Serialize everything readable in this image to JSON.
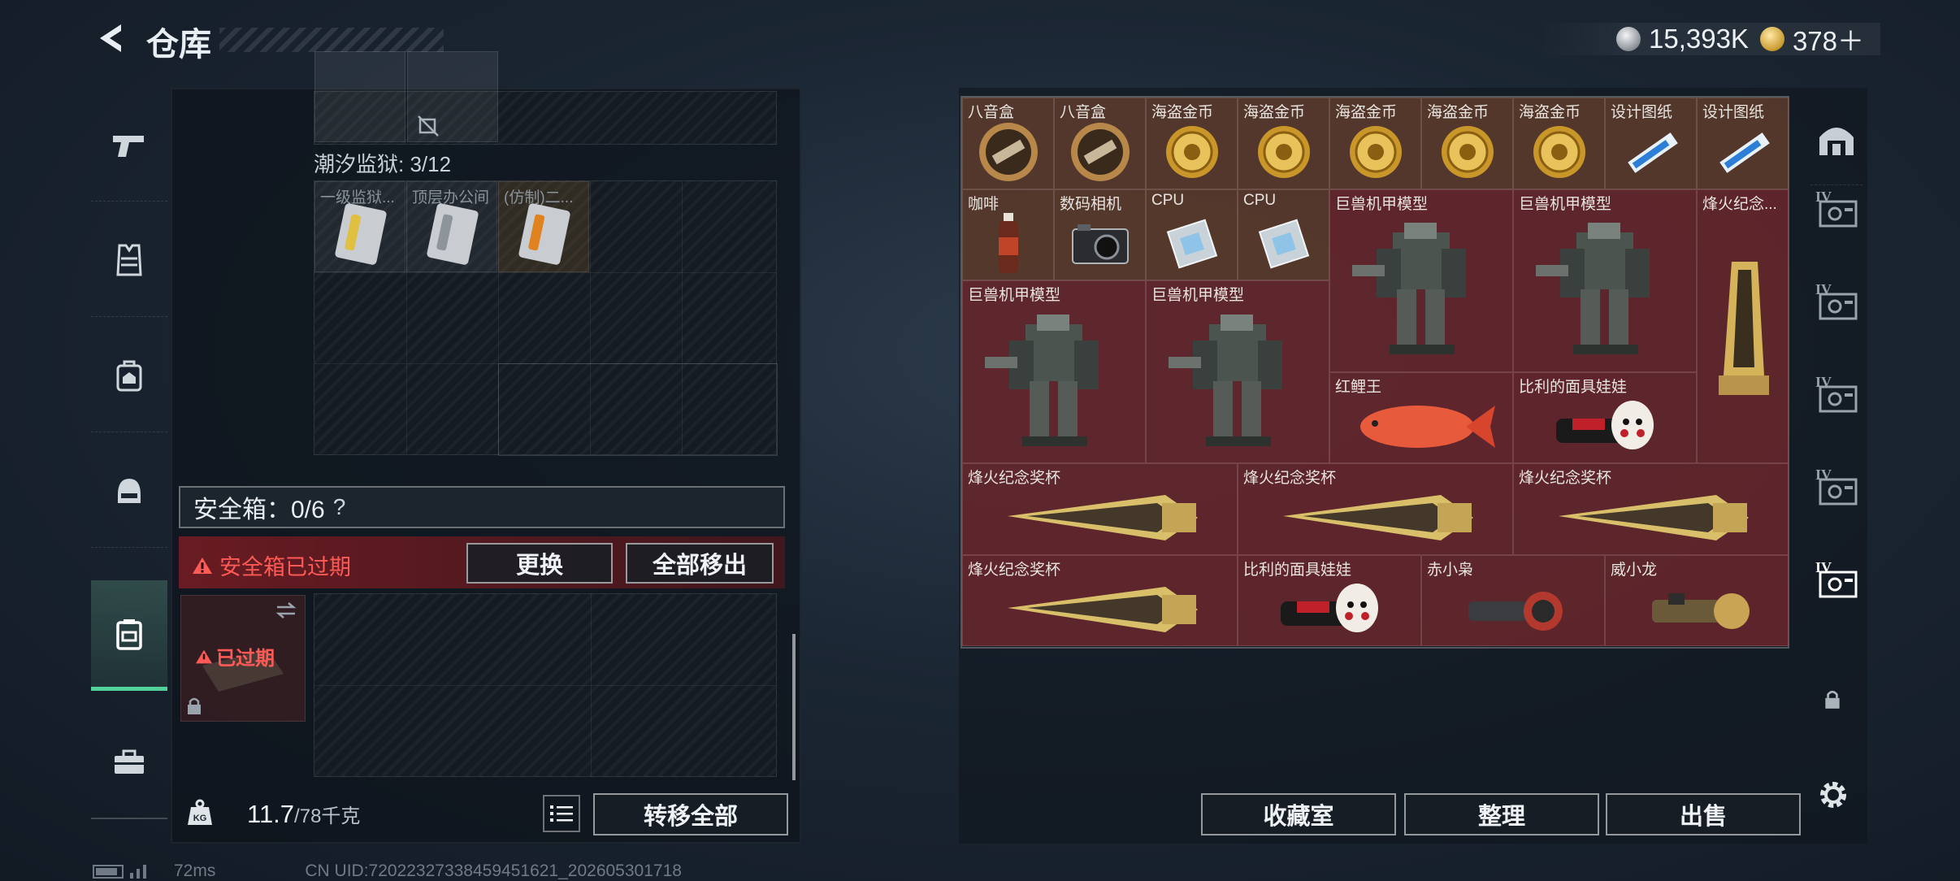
{
  "header": {
    "title": "仓库",
    "currency": [
      {
        "icon": "silver-coin-icon",
        "value": "15,393K"
      },
      {
        "icon": "gold-coin-icon",
        "value": "378＋"
      }
    ]
  },
  "left_nav": [
    "pistol-icon",
    "vest-icon",
    "backpack-icon",
    "helmet-icon",
    "safebox-icon",
    "toolbox-icon"
  ],
  "left_panel": {
    "container_label": "潮汐监狱: 3/12",
    "container_items": [
      {
        "label": "一级监狱...",
        "color": "#e0c040"
      },
      {
        "label": "顶层办公间",
        "color": "#8d949a"
      },
      {
        "label": "(仿制)二...",
        "color": "#e0821f"
      }
    ],
    "safebox_label": "安全箱：0/6",
    "safebox_help": "?",
    "safebox_expired": "安全箱已过期",
    "replace_button": "更换",
    "move_all_out_button": "全部移出",
    "secure_item_status": "已过期",
    "weight_value": "11.7",
    "weight_max": "/78千克",
    "weight_icon_text": "KG",
    "transfer_all_button": "转移全部"
  },
  "stash": {
    "items": [
      {
        "label": "八音盒",
        "art": "musicbox"
      },
      {
        "label": "八音盒",
        "art": "musicbox"
      },
      {
        "label": "海盗金币",
        "art": "coin"
      },
      {
        "label": "海盗金币",
        "art": "coin"
      },
      {
        "label": "海盗金币",
        "art": "coin"
      },
      {
        "label": "海盗金币",
        "art": "coin"
      },
      {
        "label": "海盗金币",
        "art": "coin"
      },
      {
        "label": "设计图纸",
        "art": "blueprint"
      },
      {
        "label": "设计图纸",
        "art": "blueprint"
      },
      {
        "label": "咖啡",
        "art": "coffee"
      },
      {
        "label": "数码相机",
        "art": "camera"
      },
      {
        "label": "CPU",
        "art": "cpu"
      },
      {
        "label": "CPU",
        "art": "cpu"
      },
      {
        "label": "巨兽机甲模型",
        "art": "mech"
      },
      {
        "label": "巨兽机甲模型",
        "art": "mech"
      },
      {
        "label": "烽火纪念...",
        "art": "trophy"
      },
      {
        "label": "巨兽机甲模型",
        "art": "mech"
      },
      {
        "label": "巨兽机甲模型",
        "art": "mech"
      },
      {
        "label": "红鲤王",
        "art": "fish"
      },
      {
        "label": "比利的面具娃娃",
        "art": "doll"
      },
      {
        "label": "烽火纪念奖杯",
        "art": "trophy-h"
      },
      {
        "label": "烽火纪念奖杯",
        "art": "trophy-h"
      },
      {
        "label": "烽火纪念奖杯",
        "art": "trophy-h"
      },
      {
        "label": "烽火纪念奖杯",
        "art": "trophy-h"
      },
      {
        "label": "比利的面具娃娃",
        "art": "doll"
      },
      {
        "label": "赤小枭",
        "art": "figure-red"
      },
      {
        "label": "威小龙",
        "art": "figure-gold"
      }
    ],
    "collection_button": "收藏室",
    "sort_button": "整理",
    "sell_button": "出售"
  },
  "right_nav": [
    "safe-room-icon",
    "stash-page-1-icon",
    "stash-page-2-icon",
    "stash-page-3-icon",
    "stash-page-4-icon",
    "stash-page-5-icon",
    "lock-icon",
    "settings-icon"
  ],
  "right_nav_badge": "IV",
  "footer": {
    "ping": "72ms",
    "uid": "CN UID:72022327338459451621_202605301718"
  }
}
